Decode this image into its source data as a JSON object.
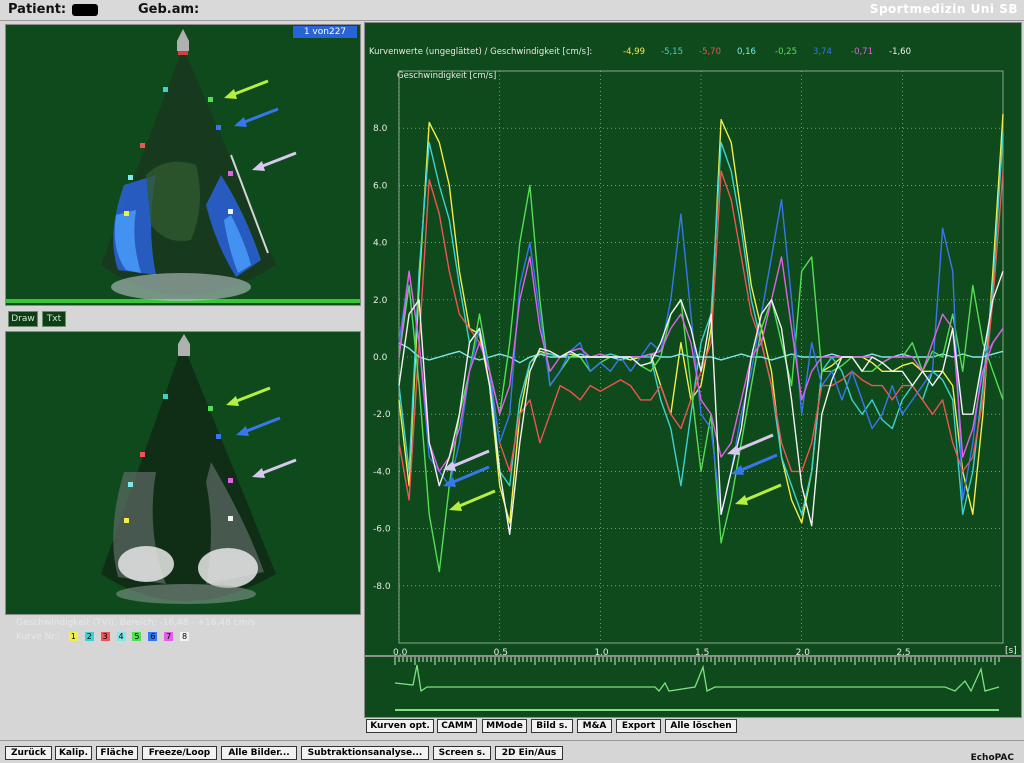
{
  "header": {
    "patient_label": "Patient:",
    "dob_label": "Geb.am:",
    "brand": "Sportmedizin Uni SB"
  },
  "viewer": {
    "frame_counter": "1 von227",
    "draw_label": "Draw",
    "txt_label": "Txt",
    "range_text": "Geschwindigkeit (TVI), Bereich: -16,48 - +16,48 cm/s",
    "curve_label": "Kurve Nr.:",
    "curve_numbers": [
      "1",
      "2",
      "3",
      "4",
      "5",
      "6",
      "7",
      "8"
    ]
  },
  "chart": {
    "header_text": "Kurvenwerte (ungeglättet) / Geschwindigkeit [cm/s]:",
    "curve_values": [
      "-4,99",
      "-5,15",
      "-5,70",
      "0,16",
      "-0,25",
      "3,74",
      "-0,71",
      "-1,60"
    ],
    "colors": {
      "yellow": "#f2ee4a",
      "cyan": "#3fd0d0",
      "red": "#ef5454",
      "light_cyan": "#80e8e8",
      "green": "#55dd55",
      "blue": "#3777ee",
      "magenta": "#e060e8",
      "white": "#f2f2f2"
    }
  },
  "buttons": {
    "chart_row": [
      "Kurven opt.",
      "CAMM",
      "MMode",
      "Bild s.",
      "M&A",
      "Export",
      "Alle löschen"
    ],
    "bottom_row": [
      "Zurück",
      "Kalip.",
      "Fläche",
      "Freeze/Loop",
      "Alle Bilder...",
      "Subtraktionsanalyse...",
      "Screen s.",
      "2D Ein/Aus"
    ]
  },
  "footer": {
    "app_name": "EchoPAC"
  },
  "chart_data": {
    "type": "line",
    "ylabel": "Geschwindigkeit [cm/s]",
    "xlabel": "[s]",
    "xlim": [
      0,
      3.0
    ],
    "ylim": [
      -10,
      10
    ],
    "x_ticks": [
      "0.0",
      "0.5",
      "1.0",
      "1.5",
      "2.0",
      "2.5"
    ],
    "y_ticks": [
      "8.0",
      "6.0",
      "4.0",
      "2.0",
      "0.0",
      "-2.0",
      "-4.0",
      "-6.0",
      "-8.0"
    ],
    "x": [
      0.0,
      0.05,
      0.1,
      0.15,
      0.2,
      0.25,
      0.3,
      0.35,
      0.4,
      0.45,
      0.5,
      0.55,
      0.6,
      0.65,
      0.7,
      0.75,
      0.8,
      0.85,
      0.9,
      0.95,
      1.0,
      1.05,
      1.1,
      1.15,
      1.2,
      1.25,
      1.3,
      1.35,
      1.4,
      1.45,
      1.5,
      1.55,
      1.6,
      1.65,
      1.7,
      1.75,
      1.8,
      1.85,
      1.9,
      1.95,
      2.0,
      2.05,
      2.1,
      2.15,
      2.2,
      2.25,
      2.3,
      2.35,
      2.4,
      2.45,
      2.5,
      2.55,
      2.6,
      2.65,
      2.7,
      2.75,
      2.8,
      2.85,
      2.9,
      2.95,
      3.0
    ],
    "series": [
      {
        "color": "yellow",
        "values": [
          -1.5,
          -4.5,
          2.5,
          8.2,
          7.5,
          6.0,
          3.0,
          1.0,
          0.8,
          -1.0,
          -4.5,
          -5.8,
          -2.0,
          -0.2,
          0.2,
          0.1,
          0.0,
          0.1,
          0.0,
          0.0,
          0.0,
          0.0,
          0.0,
          -0.1,
          0.0,
          0.1,
          -1.0,
          -2.0,
          0.5,
          -1.5,
          -1.0,
          1.0,
          8.3,
          7.5,
          5.0,
          2.5,
          1.0,
          -0.5,
          -3.5,
          -5.0,
          -5.8,
          -4.0,
          -0.5,
          -0.3,
          0.0,
          0.0,
          0.0,
          -0.2,
          -0.5,
          -0.5,
          -0.3,
          -0.2,
          -0.5,
          -0.5,
          -0.5,
          -1.0,
          -4.0,
          -5.5,
          -2.0,
          3.0,
          8.5
        ]
      },
      {
        "color": "cyan",
        "values": [
          -1.0,
          -4.0,
          3.0,
          7.5,
          6.0,
          4.8,
          2.5,
          0.5,
          1.0,
          -0.5,
          -4.0,
          -4.5,
          -1.5,
          -0.2,
          0.1,
          0.1,
          0.0,
          0.2,
          0.0,
          0.0,
          0.0,
          0.1,
          0.0,
          0.0,
          0.0,
          0.0,
          -1.5,
          -2.5,
          -4.5,
          -2.0,
          0.5,
          1.5,
          7.5,
          6.5,
          4.5,
          2.0,
          0.5,
          -1.0,
          -3.5,
          -4.5,
          -5.5,
          -4.0,
          -0.5,
          0.0,
          -0.5,
          -1.5,
          -2.0,
          -1.5,
          -2.2,
          -2.5,
          -1.5,
          -1.0,
          -1.5,
          -0.5,
          -0.8,
          -1.5,
          -5.5,
          -4.0,
          -1.0,
          2.5,
          7.8
        ]
      },
      {
        "color": "red",
        "values": [
          -3.0,
          -5.0,
          0.5,
          6.2,
          5.0,
          3.0,
          1.5,
          1.0,
          0.5,
          -0.5,
          -3.0,
          -4.0,
          -2.0,
          -1.5,
          -3.0,
          -2.0,
          -1.0,
          -1.2,
          -1.5,
          -1.0,
          -1.2,
          -1.0,
          -0.8,
          -1.0,
          -1.5,
          -1.5,
          -1.0,
          -2.0,
          -2.5,
          -1.5,
          -0.5,
          0.5,
          6.5,
          5.5,
          3.5,
          1.5,
          0.5,
          -1.0,
          -3.0,
          -4.0,
          -4.0,
          -3.0,
          -1.0,
          -1.0,
          -0.8,
          -0.5,
          -0.8,
          -1.0,
          -1.0,
          -1.5,
          -1.0,
          -1.0,
          -1.5,
          -2.0,
          -1.5,
          -3.0,
          -4.0,
          -3.5,
          -1.5,
          2.0,
          6.5
        ]
      },
      {
        "color": "light_cyan",
        "values": [
          0.5,
          0.3,
          0.0,
          -0.1,
          0.0,
          0.1,
          0.2,
          0.0,
          -0.1,
          0.0,
          0.1,
          0.0,
          -0.2,
          0.0,
          0.1,
          0.0,
          0.0,
          0.0,
          0.1,
          0.0,
          0.0,
          0.0,
          -0.1,
          0.0,
          0.0,
          0.1,
          0.0,
          0.0,
          0.1,
          0.0,
          0.0,
          0.0,
          -0.1,
          0.0,
          0.1,
          0.0,
          0.0,
          -0.1,
          0.0,
          0.1,
          0.0,
          0.0,
          0.0,
          0.1,
          0.0,
          0.0,
          0.0,
          0.1,
          0.0,
          0.0,
          0.1,
          0.0,
          0.0,
          0.0,
          0.1,
          0.0,
          0.1,
          0.0,
          0.0,
          0.1,
          0.2
        ]
      },
      {
        "color": "green",
        "values": [
          0.0,
          2.5,
          -1.0,
          -5.5,
          -7.5,
          -4.5,
          -2.0,
          -0.5,
          1.5,
          -0.5,
          -2.0,
          0.5,
          4.0,
          6.0,
          2.0,
          -1.0,
          -0.5,
          0.0,
          0.0,
          -0.5,
          -0.2,
          0.0,
          0.0,
          0.0,
          -0.3,
          -0.5,
          0.0,
          1.5,
          2.0,
          -1.0,
          -4.0,
          -2.0,
          -6.5,
          -5.0,
          -3.0,
          -1.0,
          1.0,
          2.0,
          0.5,
          -1.0,
          3.0,
          3.5,
          -0.5,
          -0.5,
          -0.3,
          0.0,
          -0.5,
          -0.5,
          -0.2,
          0.0,
          0.0,
          0.5,
          -0.5,
          0.2,
          0.0,
          1.5,
          -0.5,
          2.5,
          0.5,
          -0.5,
          -1.5
        ]
      },
      {
        "color": "blue",
        "values": [
          0.5,
          3.0,
          0.5,
          -3.5,
          -4.0,
          -4.5,
          -3.0,
          -0.5,
          1.0,
          -0.5,
          -3.0,
          -2.0,
          2.5,
          4.0,
          1.5,
          -1.0,
          -0.5,
          0.2,
          0.5,
          -0.5,
          -0.2,
          -0.5,
          0.0,
          -0.5,
          0.0,
          0.5,
          0.2,
          2.0,
          5.0,
          1.5,
          -2.0,
          -2.5,
          -5.5,
          -4.0,
          -2.0,
          -0.5,
          1.5,
          3.5,
          5.5,
          2.0,
          -2.0,
          0.5,
          -1.0,
          -0.5,
          -1.5,
          -0.5,
          -1.5,
          -2.5,
          -2.0,
          -1.0,
          -2.0,
          -1.5,
          -1.0,
          -0.5,
          4.5,
          3.0,
          -5.0,
          -3.0,
          0.0,
          0.5,
          1.0
        ]
      },
      {
        "color": "magenta",
        "values": [
          0.0,
          3.0,
          0.5,
          -3.0,
          -4.0,
          -3.5,
          -2.5,
          -0.5,
          0.5,
          -0.5,
          -2.0,
          -1.0,
          2.0,
          3.5,
          1.0,
          -0.5,
          0.0,
          0.2,
          0.3,
          0.0,
          0.1,
          0.0,
          0.0,
          0.0,
          0.0,
          0.1,
          0.2,
          1.0,
          1.5,
          0.5,
          -1.5,
          -2.0,
          -3.5,
          -3.0,
          -1.5,
          0.0,
          0.5,
          2.0,
          3.5,
          1.0,
          -1.5,
          -0.5,
          0.0,
          0.0,
          0.0,
          0.0,
          0.0,
          0.0,
          -0.2,
          0.0,
          0.0,
          0.0,
          -0.5,
          0.5,
          1.5,
          1.0,
          -3.5,
          -2.5,
          -0.5,
          0.5,
          1.0
        ]
      },
      {
        "color": "white",
        "values": [
          -1.0,
          1.5,
          2.0,
          -3.0,
          -4.5,
          -3.5,
          -2.0,
          0.5,
          1.0,
          -1.0,
          -4.0,
          -6.2,
          -3.0,
          -0.5,
          0.3,
          0.2,
          0.0,
          0.2,
          0.0,
          0.0,
          0.0,
          0.0,
          0.0,
          0.0,
          -0.3,
          -0.2,
          0.5,
          1.5,
          2.0,
          1.0,
          -0.5,
          1.5,
          -5.5,
          -4.0,
          -2.5,
          0.0,
          1.5,
          2.0,
          1.0,
          -1.5,
          -4.5,
          -5.9,
          -2.0,
          -0.8,
          0.0,
          0.0,
          -0.5,
          0.0,
          -0.2,
          -0.5,
          -0.5,
          -1.0,
          -0.5,
          -1.0,
          -0.5,
          1.0,
          -2.0,
          -2.0,
          0.0,
          2.0,
          3.0
        ]
      }
    ]
  }
}
